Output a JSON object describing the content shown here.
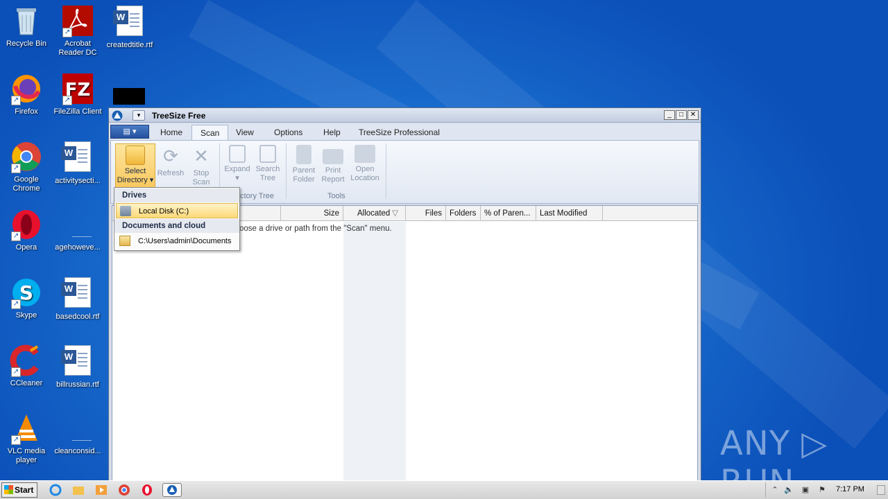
{
  "desktop": {
    "icons": [
      {
        "label": "Recycle Bin",
        "icon": "recycle-bin-icon"
      },
      {
        "label": "Acrobat Reader DC",
        "icon": "acrobat-icon"
      },
      {
        "label": "createdtitle.rtf",
        "icon": "word-doc-icon"
      },
      {
        "label": "Firefox",
        "icon": "firefox-icon"
      },
      {
        "label": "FileZilla Client",
        "icon": "filezilla-icon"
      },
      {
        "label": "Google Chrome",
        "icon": "chrome-icon"
      },
      {
        "label": "activitysecti...",
        "icon": "word-doc-icon"
      },
      {
        "label": "Opera",
        "icon": "opera-icon"
      },
      {
        "label": "agehoweve...",
        "icon": "blank-file-icon"
      },
      {
        "label": "Skype",
        "icon": "skype-icon"
      },
      {
        "label": "basedcool.rtf",
        "icon": "word-doc-icon"
      },
      {
        "label": "CCleaner",
        "icon": "ccleaner-icon"
      },
      {
        "label": "billrussian.rtf",
        "icon": "word-doc-icon"
      },
      {
        "label": "VLC media player",
        "icon": "vlc-icon"
      },
      {
        "label": "cleanconsid...",
        "icon": "blank-file-icon"
      }
    ]
  },
  "window": {
    "title": "TreeSize Free",
    "controls": {
      "minimize": "_",
      "maximize": "□",
      "close": "✕"
    },
    "tabs": [
      "Home",
      "Scan",
      "View",
      "Options",
      "Help",
      "TreeSize Professional"
    ],
    "active_tab": "Scan",
    "ribbon": {
      "buttons": [
        {
          "label1": "Select",
          "label2": "Directory",
          "enabled": true
        },
        {
          "label1": "Refresh",
          "label2": "",
          "enabled": false
        },
        {
          "label1": "Stop",
          "label2": "Scan",
          "enabled": false
        },
        {
          "label1": "Expand",
          "label2": "",
          "enabled": false
        },
        {
          "label1": "Search",
          "label2": "Tree",
          "enabled": false
        },
        {
          "label1": "Parent",
          "label2": "Folder",
          "enabled": false
        },
        {
          "label1": "Print",
          "label2": "Report",
          "enabled": false
        },
        {
          "label1": "Open",
          "label2": "Location",
          "enabled": false
        }
      ],
      "groups": [
        "ectory Tree",
        "Tools"
      ]
    },
    "columns": [
      "Size",
      "Allocated",
      "Files",
      "Folders",
      "% of Paren...",
      "Last Modified"
    ],
    "hint": "oose a drive or path from the \"Scan\" menu."
  },
  "dropdown": {
    "drives_header": "Drives",
    "drive_item": "Local Disk (C:)",
    "docs_header": "Documents and cloud",
    "docs_item": "C:\\Users\\admin\\Documents"
  },
  "taskbar": {
    "start_label": "Start",
    "clock": "7:17 PM"
  },
  "watermark": "ANY ▷ RUN"
}
